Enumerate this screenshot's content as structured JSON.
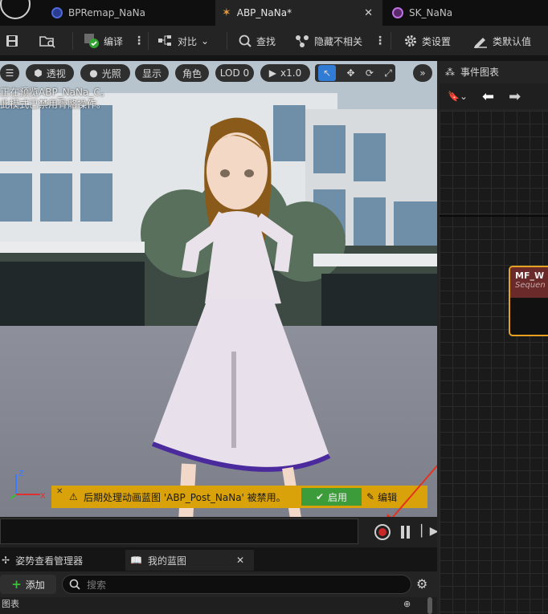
{
  "tabs": [
    {
      "label": "BPRemap_NaNa"
    },
    {
      "label": "ABP_NaNa*"
    },
    {
      "label": "SK_NaNa"
    }
  ],
  "toolbar": {
    "compile": "编译",
    "diff": "对比",
    "find": "查找",
    "hide_unrelated": "隐藏不相关",
    "class_settings": "类设置",
    "class_defaults": "类默认值"
  },
  "viewport": {
    "perspective": "透视",
    "lighting": "光照",
    "show": "显示",
    "character": "角色",
    "lod": "LOD 0",
    "speed": "x1.0",
    "note_line1": "正在预览ABP_NaNa_C。",
    "note_line2": "此模式已禁用骨骼操作。",
    "warning": "后期处理动画蓝图 'ABP_Post_NaNa' 被禁用。",
    "enable": "启用",
    "edit": "编辑"
  },
  "graph": {
    "title": "事件图表",
    "node_title": "MF_W",
    "node_sub": "Sequen"
  },
  "bottom": {
    "pose_watch": "姿势查看管理器",
    "my_blueprint": "我的蓝图",
    "add": "添加",
    "search_placeholder": "搜索",
    "section": "图表"
  },
  "colors": {
    "accent_blue": "#2f7bd6",
    "warning_yellow": "#d9a20a",
    "enable_green": "#3d9c3a",
    "record_red": "#c82828",
    "node_border": "#e6a022"
  }
}
